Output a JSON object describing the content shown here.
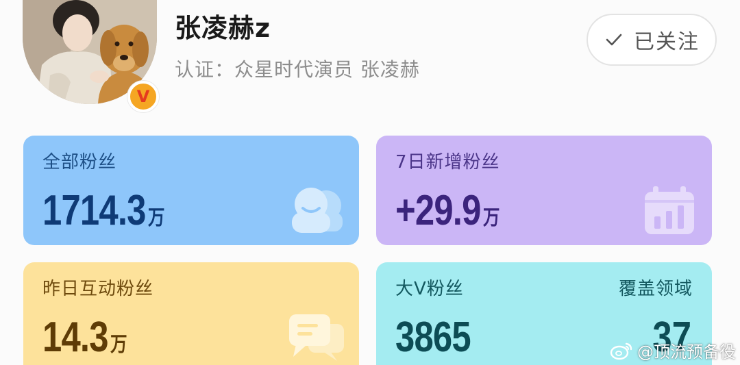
{
  "profile": {
    "username": "张凌赫z",
    "verification": "认证：众星时代演员 张凌赫",
    "verified_badge": "V"
  },
  "follow": {
    "label": "已关注",
    "icon": "check-icon"
  },
  "stats": {
    "all_fans": {
      "label": "全部粉丝",
      "value": "1714.3",
      "unit": "万",
      "icon": "users-icon",
      "color": "#8ec6fa"
    },
    "new_fans_7d": {
      "label": "7日新增粉丝",
      "value": "+29.9",
      "unit": "万",
      "icon": "calendar-icon",
      "color": "#cbb6f6"
    },
    "active_fans_yesterday": {
      "label": "昨日互动粉丝",
      "value": "14.3",
      "unit": "万",
      "icon": "message-icon",
      "color": "#fde29b"
    },
    "bigv_fans": {
      "label": "大V粉丝",
      "value": "3865",
      "coverage_label": "覆盖领域",
      "coverage_value": "37",
      "color": "#a4ecf1"
    }
  },
  "watermark": {
    "text": "@顶流预备役"
  }
}
